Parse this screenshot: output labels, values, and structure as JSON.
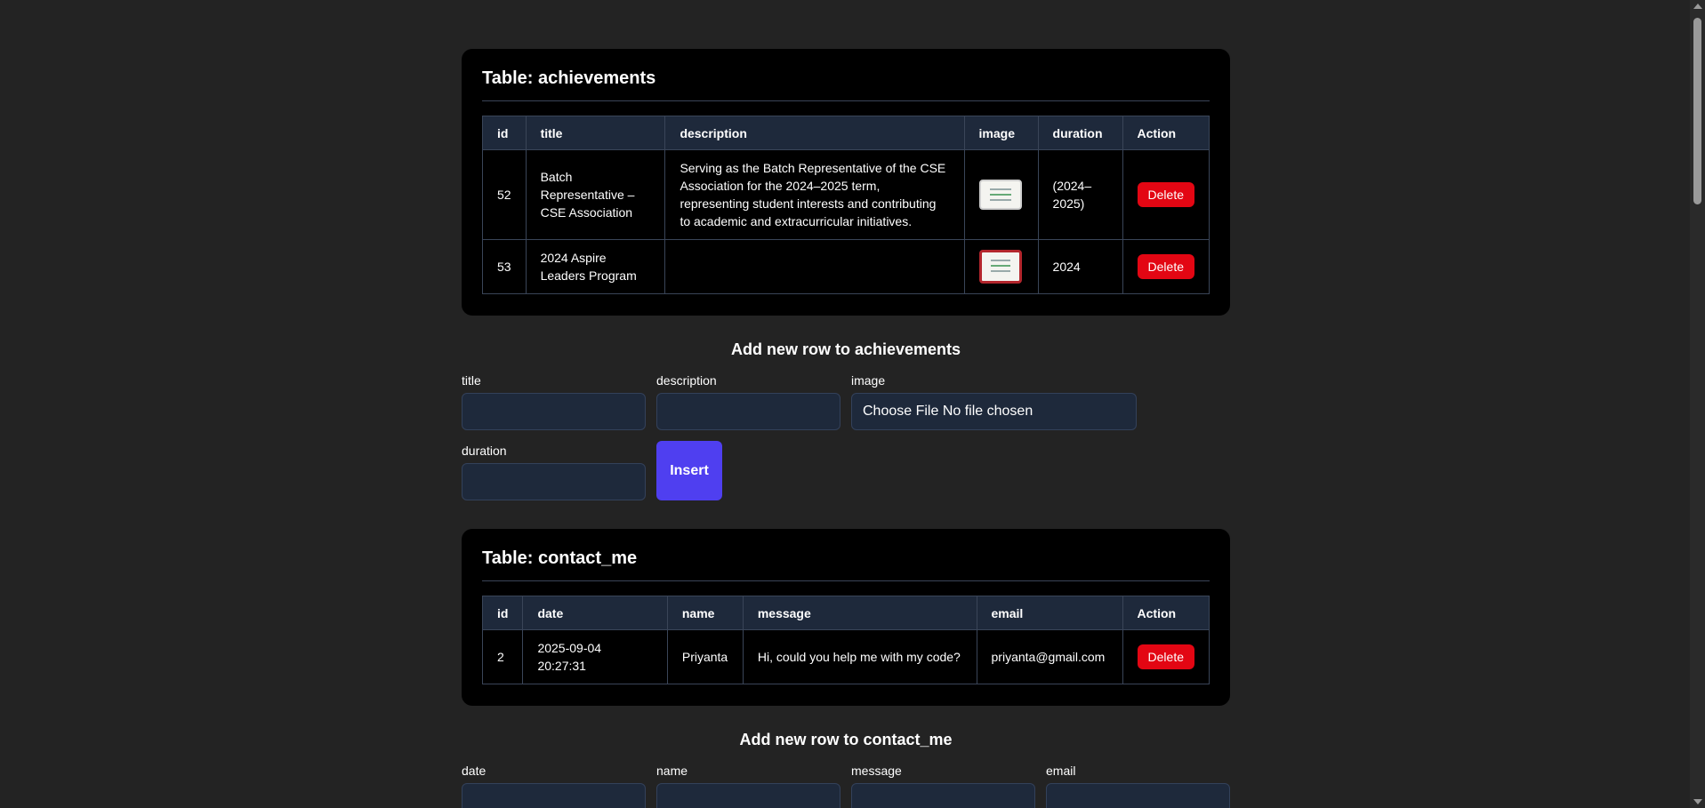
{
  "achievements": {
    "table_title": "Table: achievements",
    "columns": [
      "id",
      "title",
      "description",
      "image",
      "duration",
      "Action"
    ],
    "rows": [
      {
        "id": "52",
        "title": "Batch Representative – CSE Association",
        "description": "Serving as the Batch Representative of the CSE Association for the 2024–2025 term, representing student interests and contributing to academic and extracurricular initiatives.",
        "duration": "(2024–2025)",
        "action": "Delete"
      },
      {
        "id": "53",
        "title": "2024 Aspire Leaders Program",
        "description": "",
        "duration": "2024",
        "action": "Delete"
      }
    ],
    "form_title": "Add new row to achievements",
    "fields": {
      "title": "title",
      "description": "description",
      "image": "image",
      "duration": "duration"
    },
    "file_input_text": "Choose File No file chosen",
    "insert_label": "Insert"
  },
  "contact_me": {
    "table_title": "Table: contact_me",
    "columns": [
      "id",
      "date",
      "name",
      "message",
      "email",
      "Action"
    ],
    "rows": [
      {
        "id": "2",
        "date": "2025-09-04 20:27:31",
        "name": "Priyanta",
        "message": "Hi, could you help me with my code?",
        "email": "priyanta@gmail.com",
        "action": "Delete"
      }
    ],
    "form_title": "Add new row to contact_me",
    "fields": {
      "date": "date",
      "name": "name",
      "message": "message",
      "email": "email"
    }
  },
  "colors": {
    "background": "#232323",
    "card": "#000000",
    "header_row": "#1e293b",
    "delete": "#e30613",
    "insert": "#4f3ff0"
  }
}
